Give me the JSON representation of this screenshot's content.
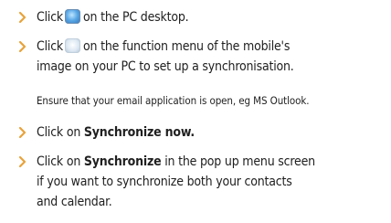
{
  "steps": [
    {
      "line1_before": "Click",
      "line1_icon": "pc-suite-icon",
      "line1_after": "on the PC desktop."
    },
    {
      "line1_before": "Click",
      "line1_icon": "sync-icon",
      "line1_after": "on the function menu of the mobile's",
      "line2": "image on your PC to set up a synchronisation."
    },
    {
      "note": "Ensure that your email application is open, eg MS Outlook."
    },
    {
      "line1_before": "Click on",
      "line1_bold": "Synchronize now."
    },
    {
      "line1_before": "Click on",
      "line1_bold": "Synchronize",
      "line1_after": "in the pop up menu screen",
      "line2": "if you want to synchronize both your contacts",
      "line3": "and calendar."
    }
  ],
  "colors": {
    "bullet": "#e8a23a",
    "text": "#1f1f1f"
  }
}
